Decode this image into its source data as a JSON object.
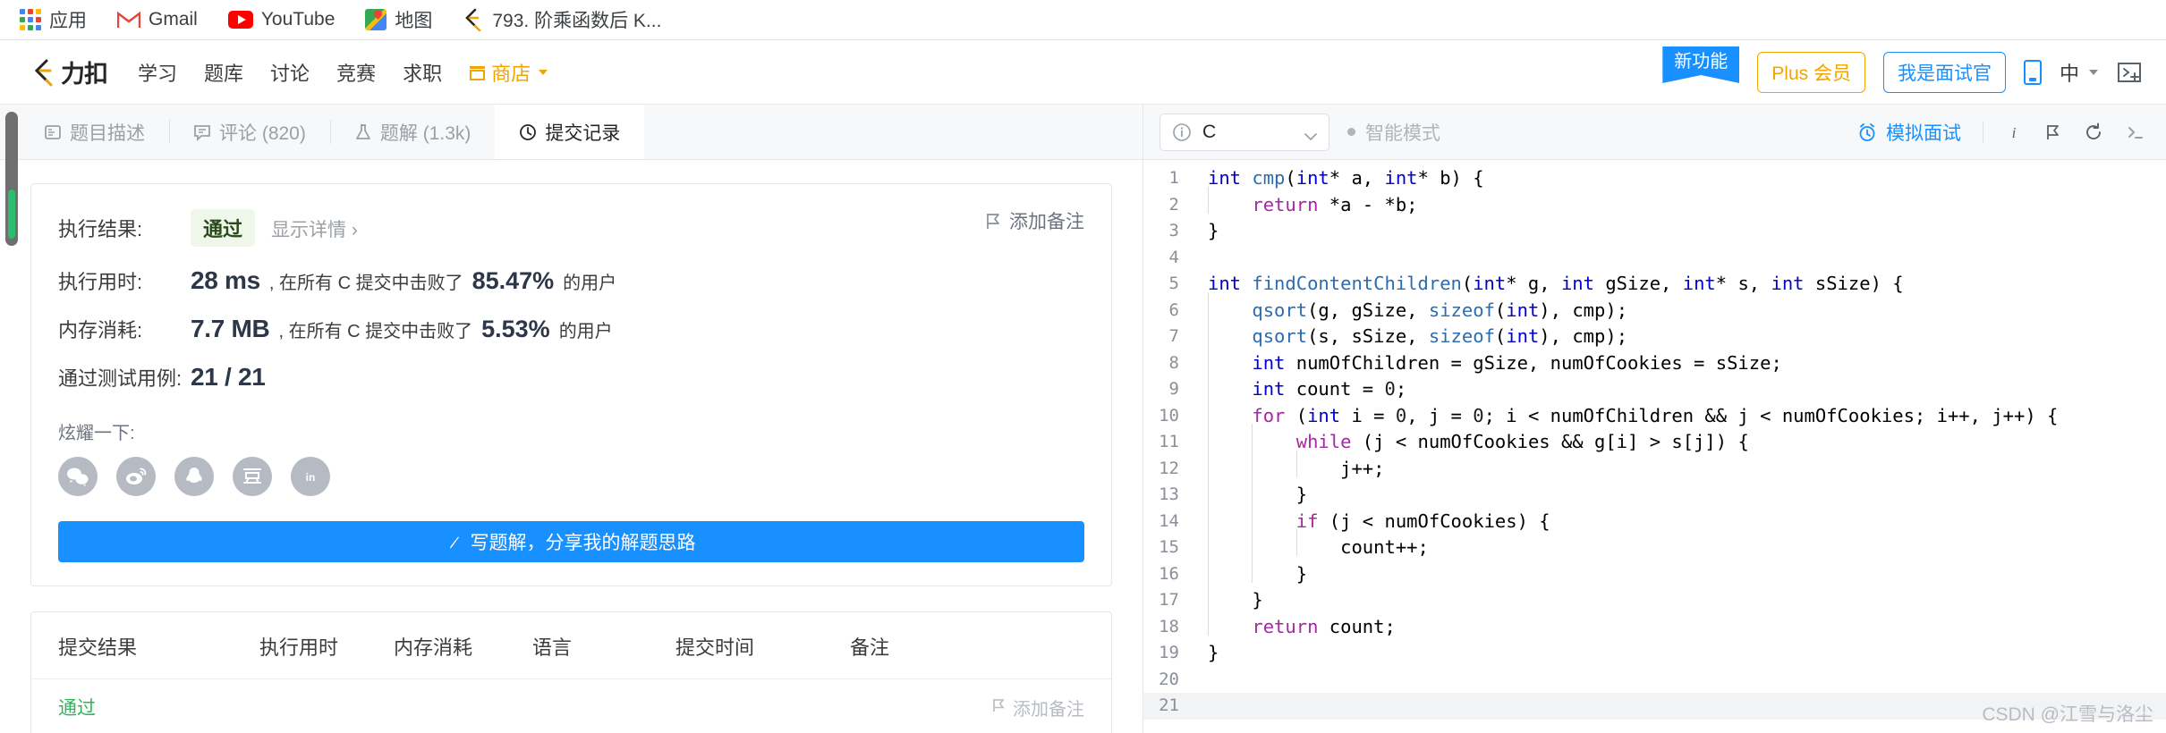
{
  "browser": {
    "bookmarks": [
      {
        "label": "应用",
        "icon": "apps-grid-icon"
      },
      {
        "label": "Gmail",
        "icon": "gmail-icon"
      },
      {
        "label": "YouTube",
        "icon": "youtube-icon"
      },
      {
        "label": "地图",
        "icon": "google-maps-icon"
      },
      {
        "label": "793. 阶乘函数后 K...",
        "icon": "leetcode-icon"
      }
    ]
  },
  "nav": {
    "logo_text": "力扣",
    "links": [
      {
        "label": "学习"
      },
      {
        "label": "题库"
      },
      {
        "label": "讨论"
      },
      {
        "label": "竞赛"
      },
      {
        "label": "求职"
      },
      {
        "label": "商店"
      }
    ],
    "ribbon_label": "新功能",
    "plus_label": "Plus 会员",
    "interviewer_label": "我是面试官",
    "lang_label": "中",
    "icons": {
      "phone": "mobile-app-icon",
      "console": "console-icon",
      "shop": "shop-icon"
    }
  },
  "tabs": [
    {
      "label": "题目描述",
      "icon": "description-icon",
      "active": false
    },
    {
      "label": "评论 (820)",
      "icon": "comment-icon",
      "active": false
    },
    {
      "label": "题解 (1.3k)",
      "icon": "solution-flask-icon",
      "active": false
    },
    {
      "label": "提交记录",
      "icon": "clock-history-icon",
      "active": true
    }
  ],
  "result": {
    "status_label": "执行结果:",
    "status_value": "通过",
    "detail_link": "显示详情 ›",
    "add_note": "添加备注",
    "runtime_label": "执行用时:",
    "runtime_value": "28 ms",
    "runtime_mid": ", 在所有 C 提交中击败了",
    "runtime_pct": "85.47%",
    "runtime_suffix": "的用户",
    "memory_label": "内存消耗:",
    "memory_value": "7.7 MB",
    "memory_mid": ", 在所有 C 提交中击败了",
    "memory_pct": "5.53%",
    "memory_suffix": "的用户",
    "testcase_label": "通过测试用例:",
    "testcase_value": "21 / 21",
    "share_label": "炫耀一下:",
    "share_icons": [
      "wechat-icon",
      "weibo-icon",
      "qq-icon",
      "douban-icon",
      "linkedin-icon"
    ],
    "write_button": "写题解，分享我的解题思路"
  },
  "submissions": {
    "columns": [
      "提交结果",
      "执行用时",
      "内存消耗",
      "语言",
      "提交时间",
      "备注"
    ],
    "rows": [
      {
        "status": "通过",
        "note": "添加备注"
      }
    ]
  },
  "editor": {
    "language": "C",
    "smart_mode": "智能模式",
    "mock_interview": "模拟面试",
    "toolbar_icons": [
      "info-icon",
      "flag-icon",
      "reset-icon",
      "console-toggle-icon"
    ],
    "watermark": "CSDN @江雪与洛尘",
    "active_line": 21,
    "lines": [
      {
        "n": 1,
        "html": "<span class='kw'>int</span> <span class='fn'>cmp</span>(<span class='kw'>int</span>* a, <span class='kw'>int</span>* b) {"
      },
      {
        "n": 2,
        "html": "<span class='ind'>    </span><span class='ctl'>return</span> *a - *b;"
      },
      {
        "n": 3,
        "html": "}"
      },
      {
        "n": 4,
        "html": ""
      },
      {
        "n": 5,
        "html": "<span class='kw'>int</span> <span class='fn'>findContentChildren</span>(<span class='kw'>int</span>* g, <span class='kw'>int</span> gSize, <span class='kw'>int</span>* s, <span class='kw'>int</span> sSize) {"
      },
      {
        "n": 6,
        "html": "<span class='ind'>    </span><span class='fn'>qsort</span>(g, gSize, <span class='fn'>sizeof</span>(<span class='kw'>int</span>), cmp);"
      },
      {
        "n": 7,
        "html": "<span class='ind'>    </span><span class='fn'>qsort</span>(s, sSize, <span class='fn'>sizeof</span>(<span class='kw'>int</span>), cmp);"
      },
      {
        "n": 8,
        "html": "<span class='ind'>    </span><span class='kw'>int</span> numOfChildren = gSize, numOfCookies = sSize;"
      },
      {
        "n": 9,
        "html": "<span class='ind'>    </span><span class='kw'>int</span> count = <span class='num'>0</span>;"
      },
      {
        "n": 10,
        "html": "<span class='ind'>    </span><span class='ctl'>for</span> (<span class='kw'>int</span> i = <span class='num'>0</span>, j = <span class='num'>0</span>; i &lt; numOfChildren &amp;&amp; j &lt; numOfCookies; i++, j++) {"
      },
      {
        "n": 11,
        "html": "<span class='ind'>    </span><span class='ind'>    </span><span class='ctl'>while</span> (j &lt; numOfCookies &amp;&amp; g[i] &gt; s[j]) {"
      },
      {
        "n": 12,
        "html": "<span class='ind'>    </span><span class='ind'>    </span><span class='ind'>    </span>j++;"
      },
      {
        "n": 13,
        "html": "<span class='ind'>    </span><span class='ind'>    </span>}"
      },
      {
        "n": 14,
        "html": "<span class='ind'>    </span><span class='ind'>    </span><span class='ctl'>if</span> (j &lt; numOfCookies) {"
      },
      {
        "n": 15,
        "html": "<span class='ind'>    </span><span class='ind'>    </span><span class='ind'>    </span>count++;"
      },
      {
        "n": 16,
        "html": "<span class='ind'>    </span><span class='ind'>    </span>}"
      },
      {
        "n": 17,
        "html": "<span class='ind'>    </span>}"
      },
      {
        "n": 18,
        "html": "<span class='ind'>    </span><span class='ctl'>return</span> count;"
      },
      {
        "n": 19,
        "html": "}"
      },
      {
        "n": 20,
        "html": ""
      },
      {
        "n": 21,
        "html": ""
      }
    ]
  },
  "colors": {
    "accent_blue": "#1890ff",
    "brand_orange": "#f0a500",
    "pass_green": "#2db55d",
    "keyword_blue": "#0000d2",
    "control_purple": "#a626a4"
  }
}
